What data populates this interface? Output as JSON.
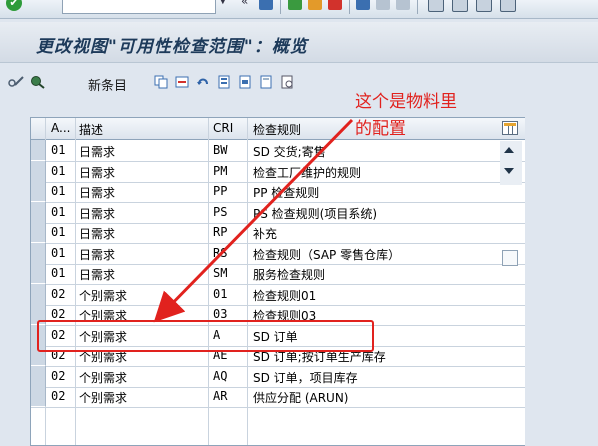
{
  "toolbar": {
    "command_field_value": "",
    "icons": [
      "check-icon",
      "dropdown-icon",
      "back-nav-icon",
      "save-icon",
      "back-icon",
      "exit-icon",
      "cancel-icon",
      "print-icon",
      "find-icon",
      "find-next-icon",
      "first-page-icon",
      "prev-page-icon",
      "next-page-icon",
      "last-page-icon"
    ]
  },
  "page": {
    "title": "更改视图\"可用性检查范围\"：概览"
  },
  "app_toolbar": {
    "new_entries_label": "新条目",
    "icons": [
      "display-change-icon",
      "other-view-icon",
      "copy-icon",
      "delete-icon",
      "undo-icon",
      "select-all-icon",
      "select-block-icon",
      "deselect-all-icon",
      "print-standard-list-icon"
    ]
  },
  "table": {
    "headers": {
      "a": "A...",
      "desc": "描述",
      "cri": "CRI",
      "rule": "检查规则"
    },
    "rows": [
      {
        "a": "01",
        "desc": "日需求",
        "cri": "BW",
        "rule": "SD 交货;寄售"
      },
      {
        "a": "01",
        "desc": "日需求",
        "cri": "PM",
        "rule": "检查工厂维护的规则"
      },
      {
        "a": "01",
        "desc": "日需求",
        "cri": "PP",
        "rule": "PP 检查规则"
      },
      {
        "a": "01",
        "desc": "日需求",
        "cri": "PS",
        "rule": "PS 检查规则(项目系统)"
      },
      {
        "a": "01",
        "desc": "日需求",
        "cri": "RP",
        "rule": "补充"
      },
      {
        "a": "01",
        "desc": "日需求",
        "cri": "RS",
        "rule": "检查规则（SAP 零售仓库）"
      },
      {
        "a": "01",
        "desc": "日需求",
        "cri": "SM",
        "rule": "服务检查规则"
      },
      {
        "a": "02",
        "desc": "个别需求",
        "cri": "01",
        "rule": "检查规则01"
      },
      {
        "a": "02",
        "desc": "个别需求",
        "cri": "03",
        "rule": "检查规则03"
      },
      {
        "a": "02",
        "desc": "个别需求",
        "cri": "A",
        "rule": "SD 订单"
      },
      {
        "a": "02",
        "desc": "个别需求",
        "cri": "AE",
        "rule": "SD 订单;按订单生产库存"
      },
      {
        "a": "02",
        "desc": "个别需求",
        "cri": "AQ",
        "rule": "SD 订单，项目库存"
      },
      {
        "a": "02",
        "desc": "个别需求",
        "cri": "AR",
        "rule": "供应分配 (ARUN)"
      }
    ]
  },
  "annotation": {
    "line1": "这个是物料里",
    "line2": "的配置",
    "color": "#e1221e"
  }
}
